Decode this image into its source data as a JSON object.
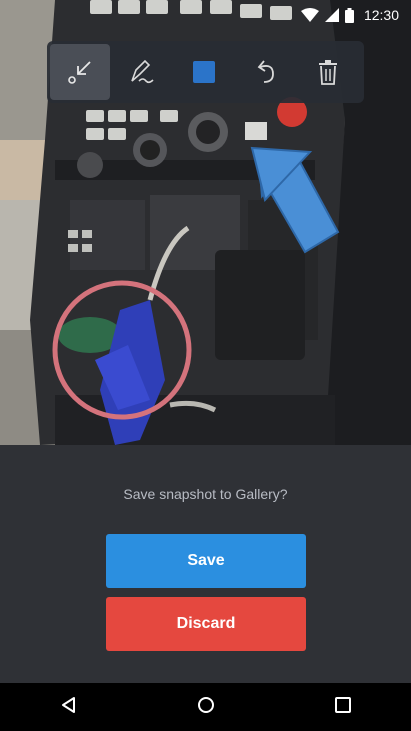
{
  "status_bar": {
    "time": "12:30",
    "icons": [
      "wifi-icon",
      "cellular-signal-icon",
      "battery-icon"
    ]
  },
  "toolbar": {
    "tools": [
      {
        "icon": "arrow-tool-icon",
        "active": true
      },
      {
        "icon": "pen-tool-icon",
        "active": false
      },
      {
        "icon": "color-swatch-icon",
        "active": false,
        "color": "#2b74c9"
      },
      {
        "icon": "undo-icon",
        "active": false
      },
      {
        "icon": "trash-icon",
        "active": false
      }
    ]
  },
  "annotations": {
    "arrow_color": "#4a8fd6",
    "circle_color": "#d4737c"
  },
  "dialog": {
    "prompt": "Save snapshot to Gallery?",
    "save_label": "Save",
    "discard_label": "Discard"
  },
  "colors": {
    "save": "#2b8fe0",
    "discard": "#e5483f",
    "background": "#2f3136"
  },
  "nav_bar": {
    "buttons": [
      "back-icon",
      "home-icon",
      "recents-icon"
    ]
  }
}
